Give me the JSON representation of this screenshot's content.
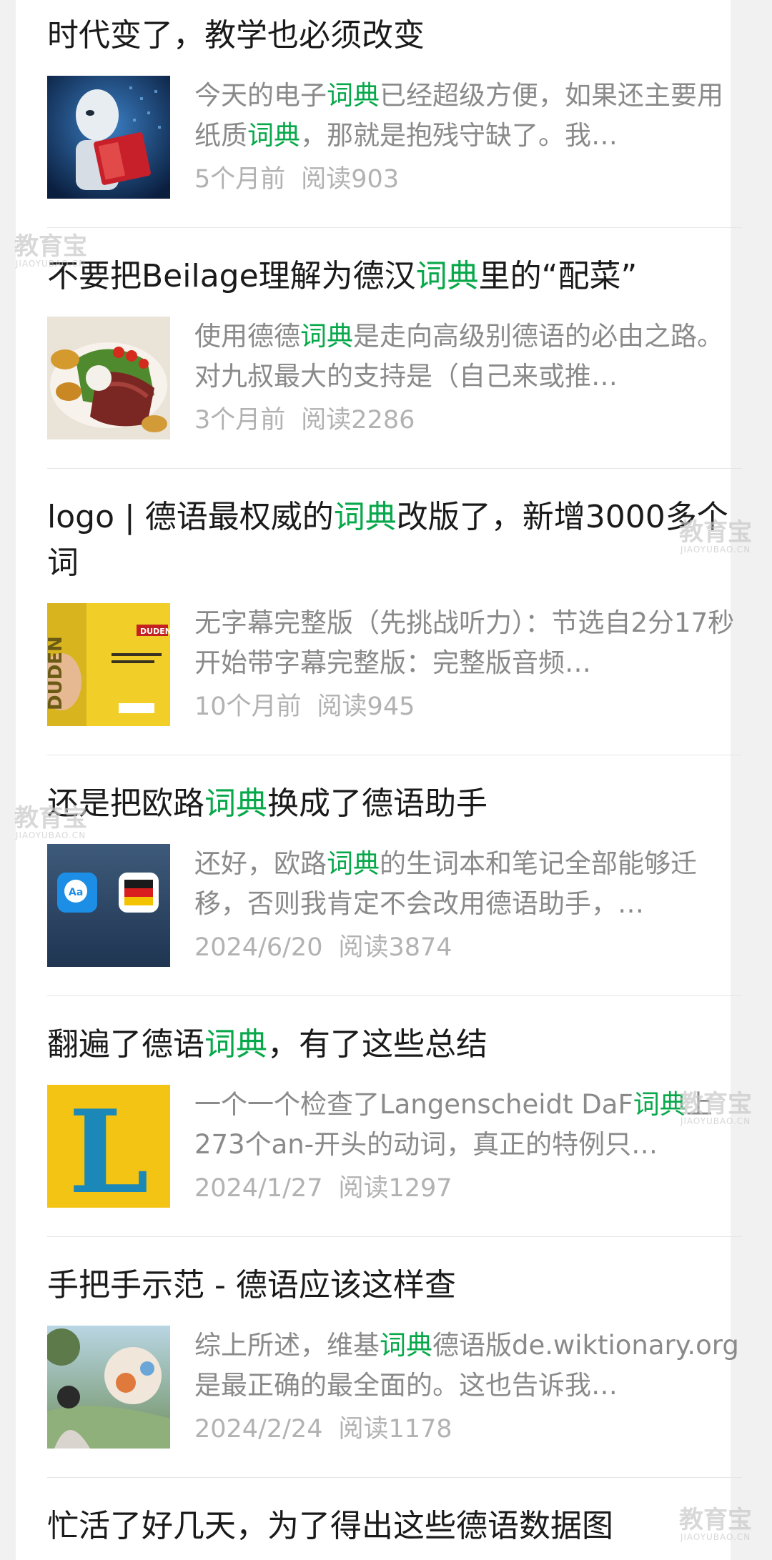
{
  "articles": [
    {
      "title": [
        "时代变了，教学也必须改变"
      ],
      "excerpt": [
        "今天的电子",
        "词典",
        "已经超级方便，如果还主要用纸质",
        "词典",
        "，那就是抱残守缺了。我…"
      ],
      "date": "5个月前",
      "reads": "阅读903",
      "thumb_icon": "robot-reading-book-image"
    },
    {
      "title": [
        "不要把Beilage理解为德汉",
        "词典",
        "里的“配菜”"
      ],
      "excerpt": [
        "使用德德",
        "词典",
        "是走向高级别德语的必由之路。对九叔最大的支持是（自己来或推…"
      ],
      "date": "3个月前",
      "reads": "阅读2286",
      "thumb_icon": "steak-salad-plate-image"
    },
    {
      "title": [
        "logo | 德语最权威的",
        "词典",
        "改版了，新增3000多个词"
      ],
      "excerpt": [
        "无字幕完整版（先挑战听力）：节选自2分17秒开始带字幕完整版：完整版音频…"
      ],
      "date": "10个月前",
      "reads": "阅读945",
      "thumb_icon": "duden-book-image",
      "thumb_text": "DUDEN"
    },
    {
      "title": [
        "还是把欧路",
        "词典",
        "换成了德语助手"
      ],
      "excerpt": [
        "还好，欧路",
        "词典",
        "的生词本和笔记全部能够迁移，否则我肯定不会改用德语助手，…"
      ],
      "date": "2024/6/20",
      "reads": "阅读3874",
      "thumb_icon": "dictionary-apps-image",
      "thumb_text": "Aa"
    },
    {
      "title": [
        "翻遍了德语",
        "词典",
        "，有了这些总结"
      ],
      "excerpt": [
        "一个一个检查了Langenscheidt DaF",
        "词典",
        "上273个an-开头的动词，真正的特例只…"
      ],
      "date": "2024/1/27",
      "reads": "阅读1297",
      "thumb_icon": "langenscheidt-logo-image",
      "thumb_text": "L"
    },
    {
      "title": [
        "手把手示范 - 德语应该这样查"
      ],
      "excerpt": [
        "综上所述，维基",
        "词典",
        "德语版de.wiktionary.org是最正确的最全面的。这也告诉我…"
      ],
      "date": "2024/2/24",
      "reads": "阅读1178",
      "thumb_icon": "fantasy-landscape-image"
    },
    {
      "title": [
        "忙活了好几天，为了得出这些德语数据图"
      ]
    }
  ],
  "watermark": {
    "main": "教育宝",
    "sub": "JIAOYUBAO.CN"
  },
  "colors": {
    "keyword": "#07a84a",
    "title": "#1a1a1a",
    "excerpt": "#8a8a8a",
    "meta": "#b2b2b2"
  }
}
